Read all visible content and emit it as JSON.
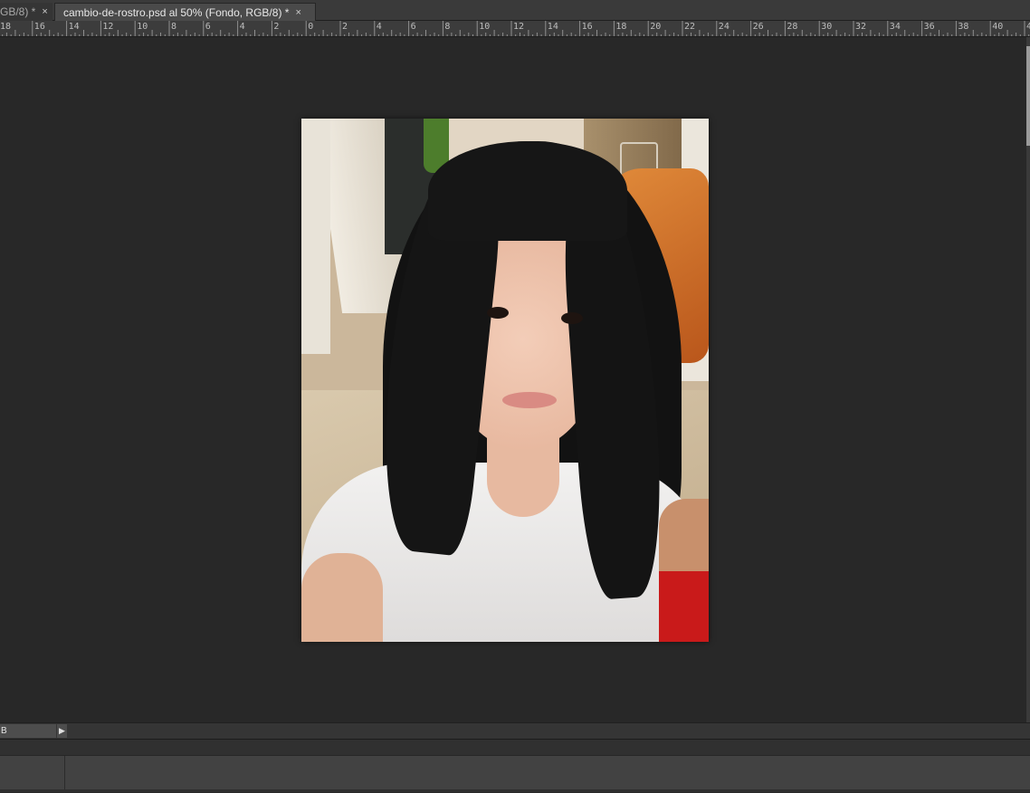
{
  "tabs": [
    {
      "label": "GB/8) *",
      "close": "×",
      "active": false
    },
    {
      "label": "cambio-de-rostro.psd al 50% (Fondo, RGB/8) *",
      "close": "×",
      "active": true
    }
  ],
  "ruler": {
    "labels": [
      "18",
      "16",
      "14",
      "12",
      "10",
      "8",
      "6",
      "4",
      "2",
      "0",
      "2",
      "4",
      "6",
      "8",
      "10",
      "12",
      "14",
      "16",
      "18",
      "20",
      "22",
      "24",
      "26",
      "28",
      "30",
      "32",
      "34",
      "36",
      "38",
      "40",
      "4"
    ]
  },
  "status": {
    "field_value": "B",
    "arrow_glyph": "▶"
  },
  "colors": {
    "workspace": "#282828",
    "ruler": "#3c3c3c",
    "tab_active": "#4a4a4a"
  }
}
